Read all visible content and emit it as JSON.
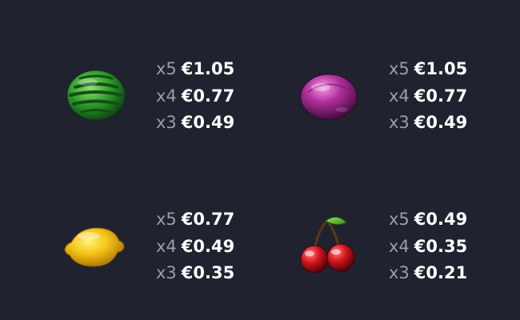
{
  "paytable": [
    {
      "symbol": "watermelon",
      "icon": "watermelon-icon",
      "rows": [
        {
          "mult": "x5",
          "amount": "€1.05"
        },
        {
          "mult": "x4",
          "amount": "€0.77"
        },
        {
          "mult": "x3",
          "amount": "€0.49"
        }
      ]
    },
    {
      "symbol": "plum",
      "icon": "plum-icon",
      "rows": [
        {
          "mult": "x5",
          "amount": "€1.05"
        },
        {
          "mult": "x4",
          "amount": "€0.77"
        },
        {
          "mult": "x3",
          "amount": "€0.49"
        }
      ]
    },
    {
      "symbol": "lemon",
      "icon": "lemon-icon",
      "rows": [
        {
          "mult": "x5",
          "amount": "€0.77"
        },
        {
          "mult": "x4",
          "amount": "€0.49"
        },
        {
          "mult": "x3",
          "amount": "€0.35"
        }
      ]
    },
    {
      "symbol": "cherry",
      "icon": "cherry-icon",
      "rows": [
        {
          "mult": "x5",
          "amount": "€0.49"
        },
        {
          "mult": "x4",
          "amount": "€0.35"
        },
        {
          "mult": "x3",
          "amount": "€0.21"
        }
      ]
    }
  ],
  "colors": {
    "background": "#20222f",
    "multiplier": "#9a9eaa",
    "amount": "#ffffff"
  }
}
